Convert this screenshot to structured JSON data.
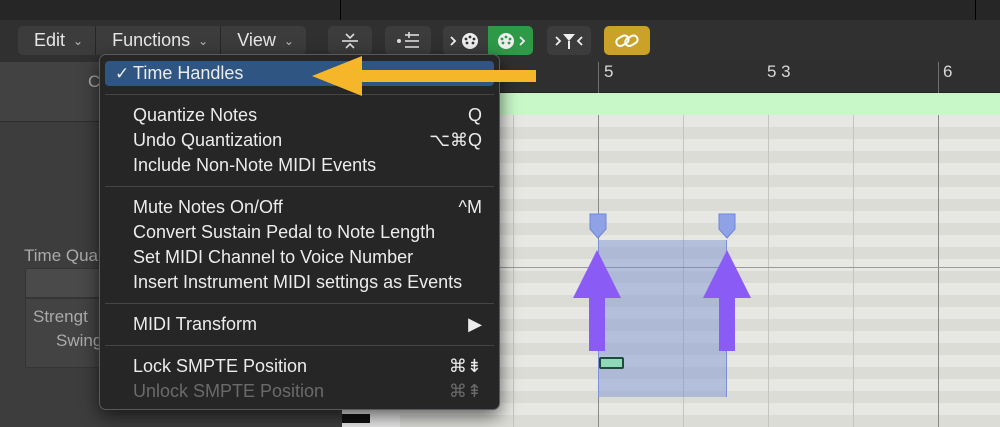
{
  "toolbar": {
    "menus": [
      {
        "label": "Edit",
        "icon": "chevron-down-icon"
      },
      {
        "label": "Functions",
        "icon": "chevron-down-icon"
      },
      {
        "label": "View",
        "icon": "chevron-down-icon"
      }
    ],
    "buttons": [
      {
        "name": "collapse-icon"
      },
      {
        "name": "list-filter-icon"
      },
      {
        "name": "midi-in-icon"
      },
      {
        "name": "midi-out-icon"
      },
      {
        "name": "catch-icon"
      },
      {
        "name": "link-icon"
      }
    ],
    "colors": {
      "midi_out_active": "#2e9a48",
      "link_active": "#c9a227"
    }
  },
  "left_panel": {
    "header_partial_label": "C",
    "time_quantize_label": "Time Qua",
    "strength_label": "Strengt",
    "swing_label": "Swing"
  },
  "ruler": {
    "labels": [
      "5",
      "5 3",
      "6"
    ]
  },
  "functions_menu": {
    "items": [
      {
        "label": "Time Handles",
        "checkmark": "✓",
        "checked": true,
        "highlighted": true,
        "shortcut": ""
      },
      {
        "label": "Quantize Notes",
        "shortcut": "Q"
      },
      {
        "label": "Undo Quantization",
        "shortcut": "⌥⌘Q"
      },
      {
        "label": "Include Non-Note MIDI Events",
        "shortcut": ""
      },
      {
        "label": "Mute Notes On/Off",
        "shortcut": "^M"
      },
      {
        "label": "Convert Sustain Pedal to Note Length",
        "shortcut": ""
      },
      {
        "label": "Set MIDI Channel to Voice Number",
        "shortcut": ""
      },
      {
        "label": "Insert Instrument MIDI settings as Events",
        "shortcut": ""
      },
      {
        "label": "MIDI Transform",
        "shortcut": "▶",
        "submenu": true
      },
      {
        "label": "Lock SMPTE Position",
        "shortcut": "⌘⇟"
      },
      {
        "label": "Unlock SMPTE Position",
        "shortcut": "⌘⇞",
        "disabled": true
      }
    ]
  },
  "annotations": {
    "arrow_color": "#f5b62a",
    "up_arrow_color": "#8a5cf5"
  },
  "colors": {
    "menu_highlight": "#2f5582",
    "region_lane": "#c8f7c8",
    "selection": "#7c8fd8",
    "note": "#8fd8b8"
  }
}
